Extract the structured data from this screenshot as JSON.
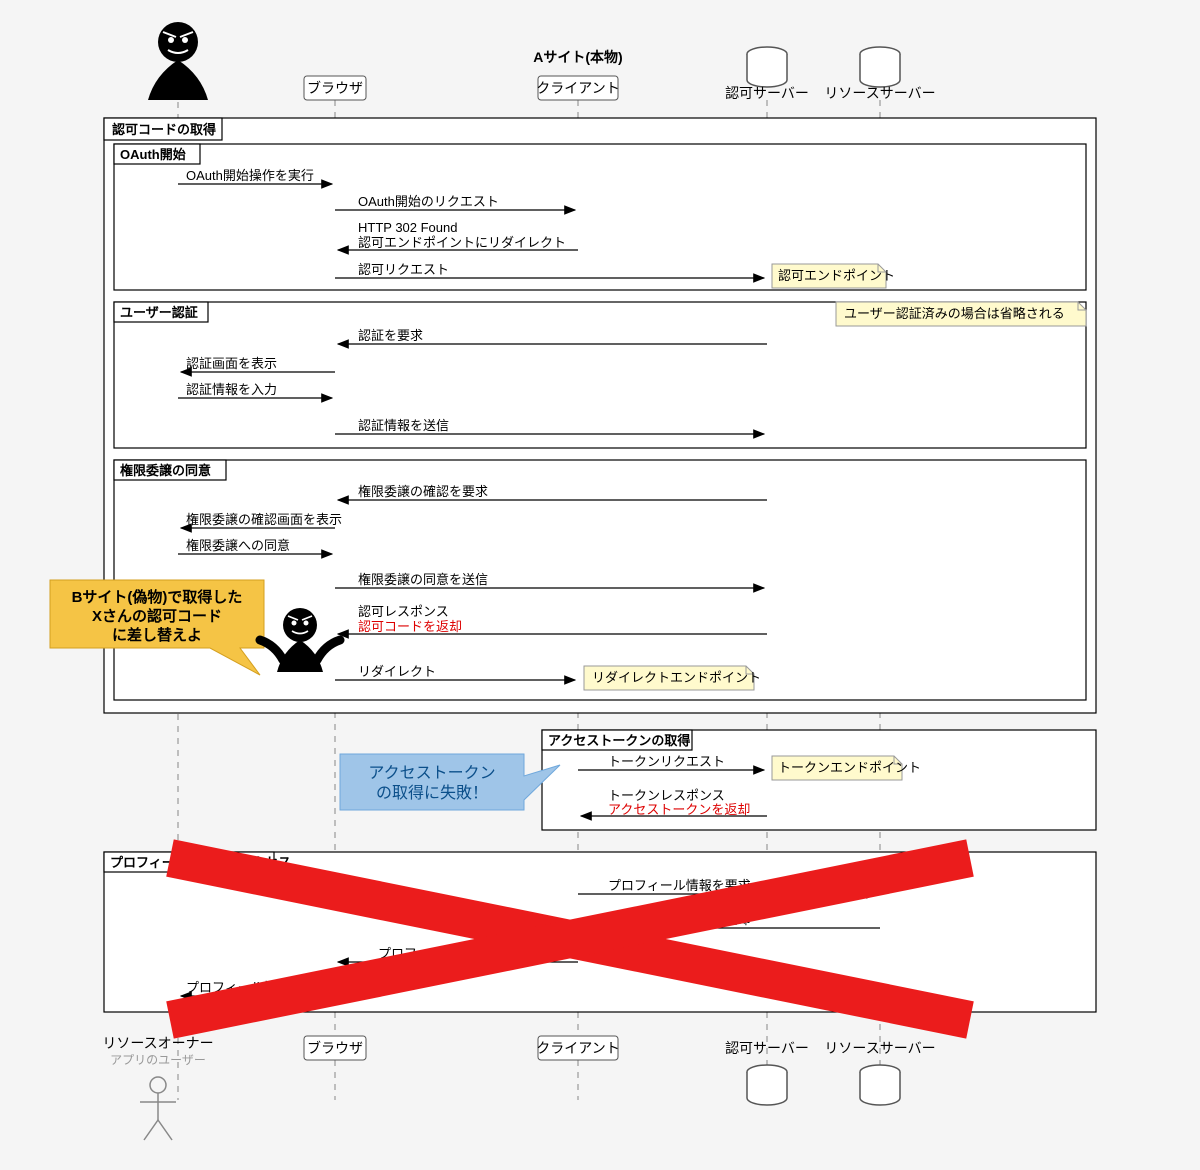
{
  "actors": {
    "attacker": "リソースオーナー",
    "attacker_sub": "アプリのユーザー",
    "browser": "ブラウザ",
    "site_a_title": "Aサイト(本物)",
    "client": "クライアント",
    "auth": "認可サーバー",
    "resource": "リソースサーバー"
  },
  "groups": {
    "g1": "認可コードの取得",
    "g1a": "OAuth開始",
    "g1b": "ユーザー認証",
    "g1c": "権限委譲の同意",
    "g2": "アクセストークンの取得",
    "g3": "プロフィール情報へのアクセス"
  },
  "messages": {
    "m1": "OAuth開始操作を実行",
    "m2": "OAuth開始のリクエスト",
    "m3a": "HTTP 302 Found",
    "m3b": "認可エンドポイントにリダイレクト",
    "m4": "認可リクエスト",
    "m5": "認証を要求",
    "m6": "認証画面を表示",
    "m7": "認証情報を入力",
    "m8": "認証情報を送信",
    "m9": "権限委譲の確認を要求",
    "m10": "権限委譲の確認画面を表示",
    "m11": "権限委譲への同意",
    "m12": "権限委譲の同意を送信",
    "m13a": "認可レスポンス",
    "m13b": "認可コードを返却",
    "m14": "リダイレクト",
    "m15": "トークンリクエスト",
    "m16a": "トークンレスポンス",
    "m16b": "アクセストークンを返却",
    "m17": "プロフィール情報を要求",
    "m18": "プロフィール情報を返却",
    "m19": "プロフィール情報を表示",
    "m20": "プロフィール情報を表示"
  },
  "notes": {
    "n1": "認可エンドポイント",
    "n2": "ユーザー認証済みの場合は省略される",
    "n3": "リダイレクトエンドポイント",
    "n4": "トークンエンドポイント"
  },
  "speech": {
    "yellow1": "Bサイト(偽物)で取得した",
    "yellow2": "Xさんの認可コード",
    "yellow3": "に差し替えよ",
    "blue1": "アクセストークン",
    "blue2": "の取得に失敗！"
  },
  "colors": {
    "red": "#eb1c1c",
    "yellow_speech": "#f5c445",
    "blue_speech": "#9fc5e8",
    "note": "#fffacd"
  }
}
